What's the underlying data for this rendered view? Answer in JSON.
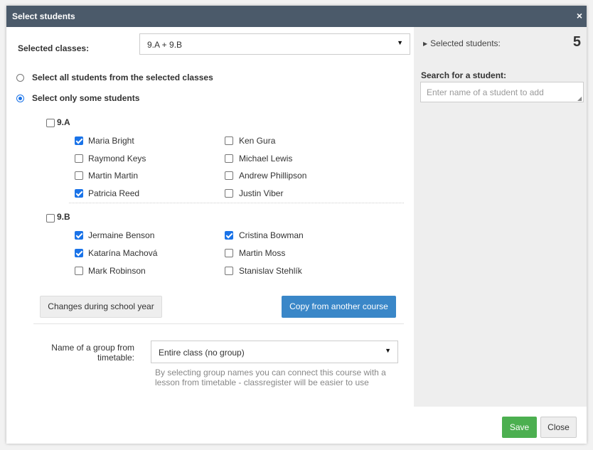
{
  "dialog": {
    "title": "Select students",
    "close_icon": "×"
  },
  "classes": {
    "label": "Selected classes:",
    "value": "9.A + 9.B"
  },
  "options": {
    "all_label": "Select all students from the selected classes",
    "some_label": "Select only some students",
    "selected": "some"
  },
  "class_groups": [
    {
      "name": "9.A",
      "checked": false,
      "students": [
        {
          "name": "Maria Bright",
          "checked": true
        },
        {
          "name": "Ken Gura",
          "checked": false
        },
        {
          "name": "Raymond Keys",
          "checked": false
        },
        {
          "name": "Michael Lewis",
          "checked": false
        },
        {
          "name": "Martin Martin",
          "checked": false
        },
        {
          "name": "Andrew Phillipson",
          "checked": false
        },
        {
          "name": "Patricia Reed",
          "checked": true
        },
        {
          "name": "Justin Viber",
          "checked": false
        }
      ]
    },
    {
      "name": "9.B",
      "checked": false,
      "students": [
        {
          "name": "Jermaine Benson",
          "checked": true
        },
        {
          "name": "Cristina Bowman",
          "checked": true
        },
        {
          "name": "Katarína Machová",
          "checked": true
        },
        {
          "name": "Martin Moss",
          "checked": false
        },
        {
          "name": "Mark Robinson",
          "checked": false
        },
        {
          "name": "Stanislav Stehlík",
          "checked": false
        }
      ]
    }
  ],
  "buttons": {
    "changes": "Changes during school year",
    "copy": "Copy from another course",
    "save": "Save",
    "close": "Close"
  },
  "group": {
    "label": "Name of a group from timetable:",
    "value": "Entire class (no group)",
    "hint": "By selecting group names you can connect this course with a lesson from timetable - classregister will be easier to use"
  },
  "sidebar": {
    "selected_label": "Selected students:",
    "selected_count": "5",
    "search_label": "Search for a student:",
    "search_placeholder": "Enter name of a student to add"
  },
  "colors": {
    "titlebar": "#4b5a6a",
    "accent_blue": "#1a73e8",
    "copy_button": "#3a87c8",
    "save_button": "#4caf50"
  },
  "icons": {
    "dialog_close": "close-icon",
    "dropdown": "caret-down-icon",
    "expand": "triangle-right-icon",
    "resize": "resize-grip-icon"
  }
}
